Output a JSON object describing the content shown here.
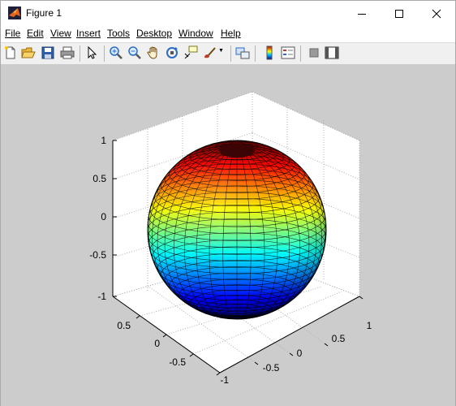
{
  "window": {
    "title": "Figure 1"
  },
  "menu": {
    "items": [
      "File",
      "Edit",
      "View",
      "Insert",
      "Tools",
      "Desktop",
      "Window",
      "Help"
    ]
  },
  "toolbar": {
    "buttons": [
      "new-figure-icon",
      "open-file-icon",
      "save-icon",
      "print-icon",
      "edit-plot-arrow-icon",
      "zoom-in-icon",
      "zoom-out-icon",
      "pan-hand-icon",
      "rotate-3d-icon",
      "data-cursor-icon",
      "brush-icon",
      "link-plot-icon",
      "insert-colorbar-icon",
      "insert-legend-icon",
      "hide-plot-tools-icon",
      "show-plot-tools-icon"
    ]
  },
  "colors": {
    "figure_bg": "#cccccc",
    "axes_bg": "#ffffff",
    "colormap": "jet"
  },
  "chart_data": {
    "type": "surface",
    "surface": "unit sphere",
    "colormap": "jet",
    "color_by": "z",
    "mesh_lines": true,
    "xlim": [
      -1,
      1
    ],
    "ylim": [
      -1,
      1
    ],
    "zlim": [
      -1,
      1
    ],
    "x_ticks": [
      "-0.5",
      "0",
      "0.5",
      "1"
    ],
    "y_ticks": [
      "-1",
      "-0.5",
      "0",
      "0.5"
    ],
    "z_ticks": [
      "-1",
      "-0.5",
      "0",
      "0.5",
      "1"
    ],
    "grid": true,
    "box": true,
    "view": "default 3-D"
  }
}
